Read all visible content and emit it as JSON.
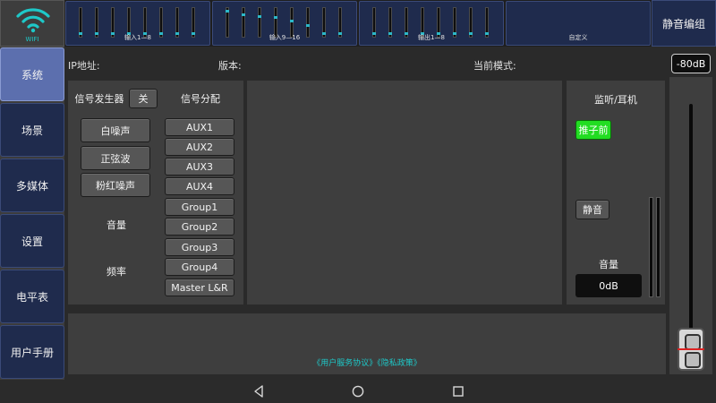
{
  "topbar": {
    "wifi_label": "WIFI",
    "banks": [
      {
        "label": "输入1—8",
        "levels": [
          0.1,
          0.1,
          0.1,
          0.1,
          0.1,
          0.1,
          0.1,
          0.1
        ]
      },
      {
        "label": "输入9—16",
        "levels": [
          0.92,
          0.8,
          0.75,
          0.7,
          0.55,
          0.4,
          0.1,
          0.1
        ]
      },
      {
        "label": "输出1—8",
        "levels": [
          0.1,
          0.1,
          0.1,
          0.1,
          0.1,
          0.1,
          0.1,
          0.1
        ]
      },
      {
        "label": "自定义",
        "levels": []
      }
    ],
    "mute_group_label": "静音编组"
  },
  "sidebar": {
    "items": [
      {
        "label": "系统",
        "active": true
      },
      {
        "label": "场景",
        "active": false
      },
      {
        "label": "多媒体",
        "active": false
      },
      {
        "label": "设置",
        "active": false
      },
      {
        "label": "电平表",
        "active": false
      },
      {
        "label": "用户手册",
        "active": false
      }
    ]
  },
  "info": {
    "ip_label": "IP地址:",
    "version_label": "版本:",
    "mode_label": "当前模式:",
    "level_badge": "-80dB"
  },
  "generator": {
    "title": "信号发生器",
    "toggle_label": "关",
    "buttons": [
      "白噪声",
      "正弦波",
      "粉红噪声"
    ],
    "volume_label": "音量",
    "frequency_label": "频率"
  },
  "routing": {
    "title": "信号分配",
    "items": [
      "AUX1",
      "AUX2",
      "AUX3",
      "AUX4",
      "Group1",
      "Group2",
      "Group3",
      "Group4",
      "Master L&R"
    ]
  },
  "monitor": {
    "title": "监听/耳机",
    "prefader_label": "推子前",
    "mute_label": "静音",
    "volume_label": "音量",
    "volume_value": "0dB"
  },
  "footer": {
    "links_text": "《用户服务协议》《隐私政策》"
  },
  "colors": {
    "accent_cyan": "#1ec8c8",
    "active_green": "#22dd22",
    "bank_blue": "#1f2b4d",
    "sidebar_active": "#5c6fae"
  }
}
